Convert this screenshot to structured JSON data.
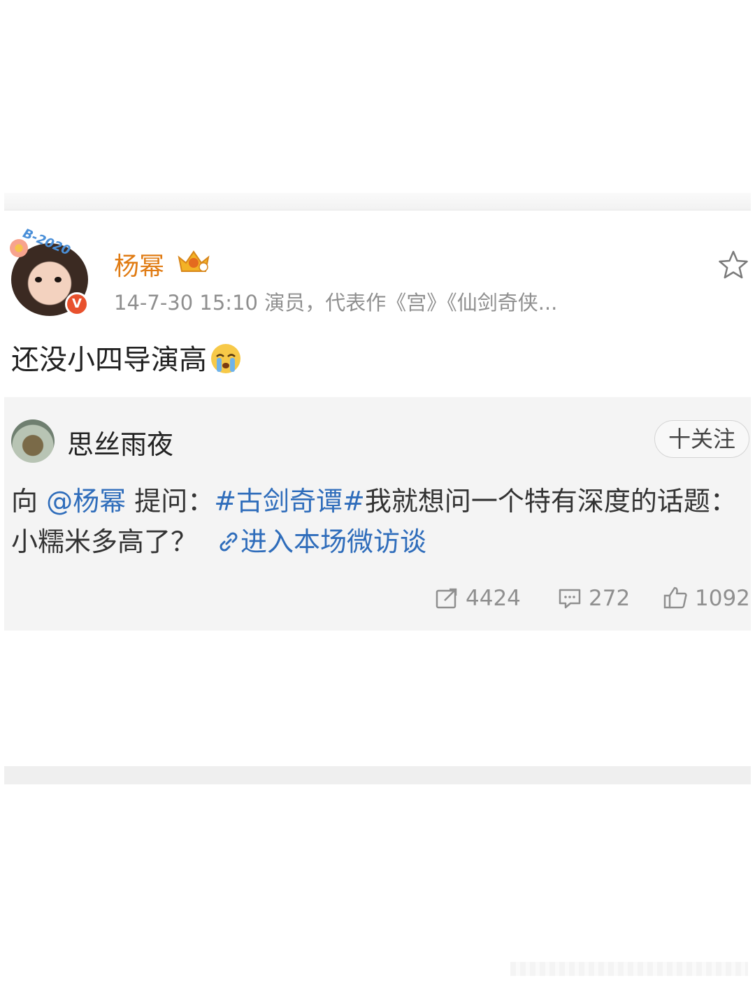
{
  "post": {
    "author": "杨幂",
    "avatar_badge": "B-2020",
    "verified_mark": "V",
    "timestamp_meta": "14-7-30 15:10  演员，代表作《宫》《仙剑奇侠...",
    "text": "还没小四导演高",
    "emoji": "crying-face-icon",
    "accent_color": "#e07b13"
  },
  "quoted": {
    "author": "思丝雨夜",
    "follow_label": "十关注",
    "line_prefix": "向 ",
    "mention": "@杨幂",
    "line_mid": " 提问：",
    "hashtag": "#古剑奇谭#",
    "line_rest": "我就想问一个特有深度的话题：小糯米多高了？",
    "link_text": "进入本场微访谈",
    "link_color": "#2f6dbb"
  },
  "actions": {
    "repost_count": "4424",
    "comment_count": "272",
    "like_count": "1092"
  }
}
